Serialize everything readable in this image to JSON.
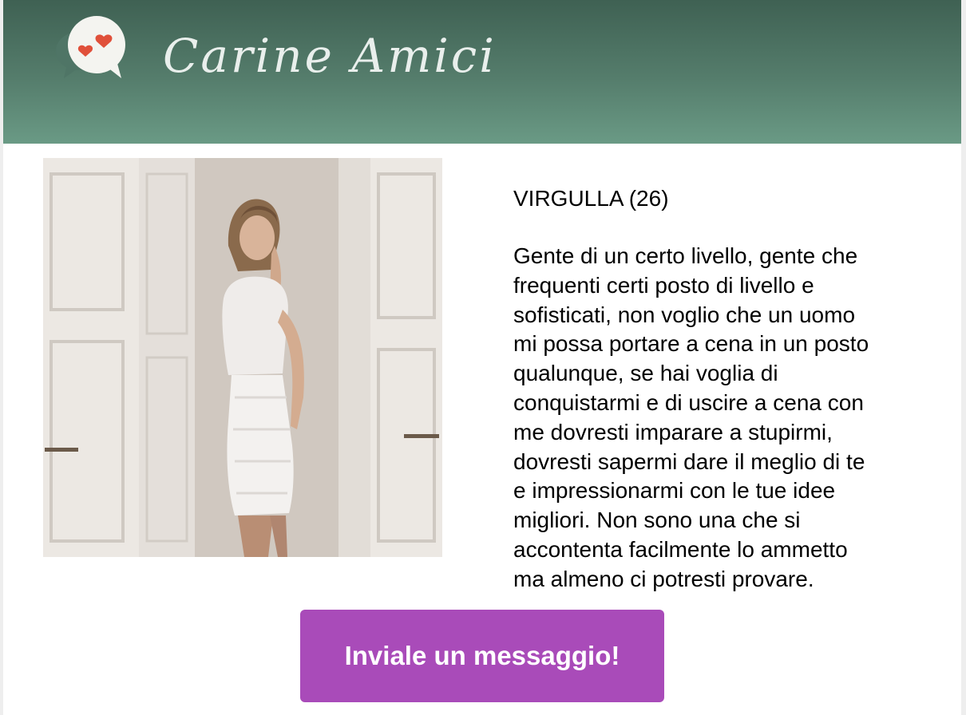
{
  "header": {
    "brand_name": "Carine Amici",
    "logo_icon": "chat-bubble-hearts-icon",
    "colors": {
      "header_top": "#3f6153",
      "header_bottom": "#6a9a85",
      "heart": "#e0503a"
    }
  },
  "profile": {
    "name_age": "VIRGULLA (26)",
    "photo": "profile-photo",
    "bio_lines": [
      "Gente di un certo livello, gente che",
      "frequenti certi posto di livello e",
      "sofisticati, non voglio che un uomo",
      "mi possa portare a cena in un posto",
      "qualunque, se hai voglia di",
      "conquistarmi e di uscire a cena con",
      "me dovresti imparare a stupirmi,",
      "dovresti sapermi dare il meglio di te",
      "e impressionarmi con le tue idee",
      "migliori. Non sono una che si",
      "accontenta facilmente lo ammetto",
      "ma almeno ci potresti provare."
    ]
  },
  "cta": {
    "label": "Inviale un messaggio!",
    "color": "#a94bb9"
  }
}
